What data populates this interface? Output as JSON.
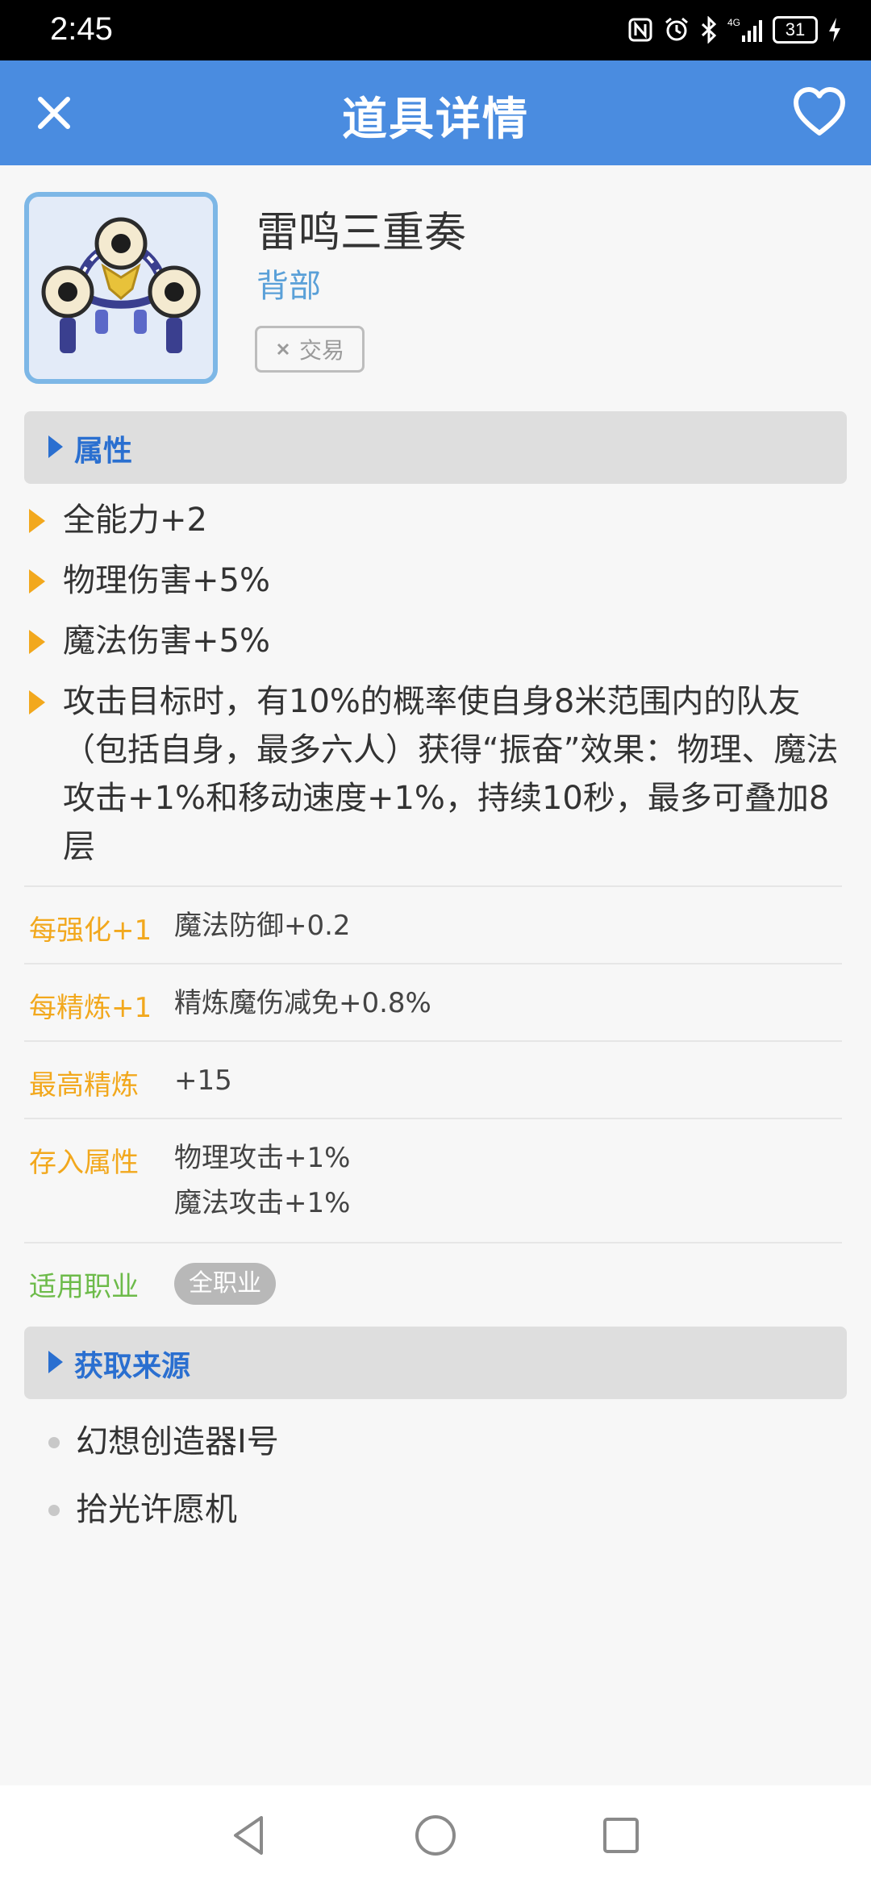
{
  "status_bar": {
    "time": "2:45",
    "battery": "31",
    "icons": [
      "nfc-icon",
      "alarm-icon",
      "bluetooth-icon",
      "4g-signal-icon",
      "battery-icon",
      "charging-icon"
    ]
  },
  "app_bar": {
    "title": "道具详情",
    "close_icon": "close-icon",
    "favorite_icon": "heart-icon",
    "color": "#4a8ce0"
  },
  "item": {
    "name": "雷鸣三重奏",
    "category": "背部",
    "trade_label": "交易",
    "trade_icon": "x-icon"
  },
  "sections": {
    "attributes": "属性",
    "sources": "获取来源"
  },
  "attributes": [
    "全能力+2",
    "物理伤害+5%",
    "魔法伤害+5%",
    "攻击目标时，有10%的概率使自身8米范围内的队友（包括自身，最多六人）获得“振奋”效果：物理、魔法攻击+1%和移动速度+1%，持续10秒，最多可叠加8层"
  ],
  "info": {
    "enhance_key": "每强化+1",
    "enhance_value": "魔法防御+0.2",
    "refine_key": "每精炼+1",
    "refine_value": "精炼魔伤减免+0.8%",
    "max_refine_key": "最高精炼",
    "max_refine_value": "+15",
    "deposit_key": "存入属性",
    "deposit_values": [
      "物理攻击+1%",
      "魔法攻击+1%"
    ],
    "job_key": "适用职业",
    "job_value": "全职业"
  },
  "sources": [
    "幻想创造器I号",
    "拾光许愿机"
  ],
  "nav": [
    "back-icon",
    "home-icon",
    "recents-icon"
  ],
  "colors": {
    "accent_orange": "#f2a81d",
    "accent_green": "#6dbb4a",
    "section_blue": "#2a6fd0",
    "category_blue": "#5aa0d8"
  }
}
